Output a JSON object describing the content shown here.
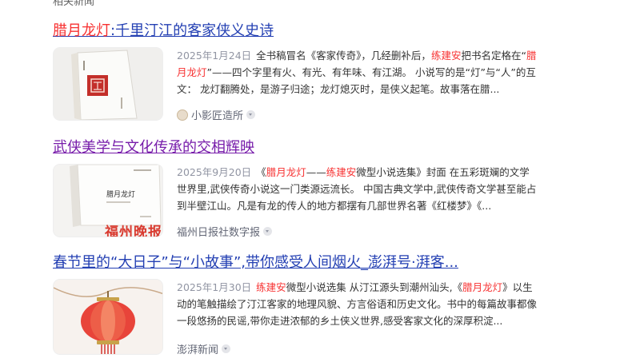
{
  "top_cut_text": "相关新闻",
  "results": [
    {
      "title_prefix": "",
      "title_hl": "腊月龙灯",
      "title_rest": ":千里汀江的客家侠义史诗",
      "date": "2025年1月24日",
      "abstract": [
        {
          "t": "全书稿冒名《客家传奇》，几经删补后，"
        },
        {
          "t": "练建安",
          "hl": true
        },
        {
          "t": "把书名定格在“"
        },
        {
          "t": "腊月龙灯",
          "hl": true
        },
        {
          "t": "”——四个字里有火、有光、有年味、有江湖。 小说写的是“灯”与“人”的互文： 龙灯翻腾处，是游子归途；龙灯熄灭时，是侠义起笔。故事落在腊..."
        }
      ],
      "source": "小影匠造所",
      "thumb": "book-cover-red-seal"
    },
    {
      "title_prefix": "武侠美学与文化传承的交相辉映",
      "title_hl": "",
      "title_rest": "",
      "date": "2025年9月20日",
      "abstract": [
        {
          "t": "《"
        },
        {
          "t": "腊月龙灯",
          "hl": true
        },
        {
          "t": "——"
        },
        {
          "t": "练建安",
          "hl": true
        },
        {
          "t": "微型小说选集》封面 在五彩斑斓的文学世界里,武侠传奇小说这一门类源远流长。 中国古典文学中,武侠传奇文学甚至能占到半壁江山。凡是有龙的传人的地方都摆有几部世界名著《红楼梦》《..."
        }
      ],
      "source": "福州日报社数字报",
      "thumb": "book-cover-white",
      "thumb_caption": "福州晚报",
      "book_title": "腊月龙灯"
    },
    {
      "title_prefix": "春节里的“大日子”与“小故事”,带你感受人间烟火_澎湃号·湃客...",
      "title_hl": "",
      "title_rest": "",
      "date": "2025年1月30日",
      "abstract": [
        {
          "t": "练建安",
          "hl": true
        },
        {
          "t": "微型小说选集 从汀江源头到潮州汕头,《"
        },
        {
          "t": "腊月龙灯",
          "hl": true
        },
        {
          "t": "》以生动的笔触描绘了汀江客家的地理风貌、方言俗语和历史文化。书中的每篇故事都像一段悠扬的民谣,带你走进浓郁的乡土侠义世界,感受客家文化的深厚积淀..."
        }
      ],
      "source": "澎湃新闻",
      "thumb": "red-lantern"
    }
  ],
  "colors": {
    "title_link": "#2440b3",
    "title_visited": "#771caa",
    "highlight": "#f73131",
    "date": "#9195a3"
  }
}
